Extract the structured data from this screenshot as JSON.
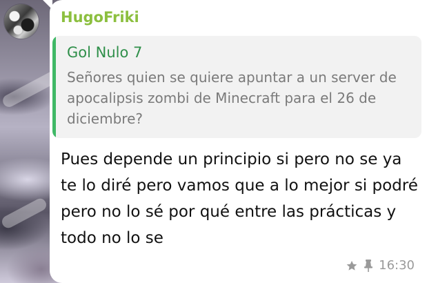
{
  "message": {
    "sender": "HugoFriki",
    "reply": {
      "author": "Gol Nulo 7",
      "text": "Señores quien se quiere apuntar a un server de apocalipsis zombi de Minecraft para el 26 de diciembre?"
    },
    "text": "Pues depende un principio si pero no se ya te lo diré pero vamos que a lo mejor si podré pero no lo sé por qué entre las prácticas y todo no lo se",
    "time": "16:30",
    "icons": [
      "star-icon",
      "pin-icon"
    ]
  },
  "colors": {
    "sender": "#8cbf3f",
    "reply_bar": "#3fb866",
    "reply_author": "#2f8f4a",
    "reply_background": "#f2f2f2",
    "bubble": "#ffffff",
    "meta": "#9a9a9a"
  }
}
